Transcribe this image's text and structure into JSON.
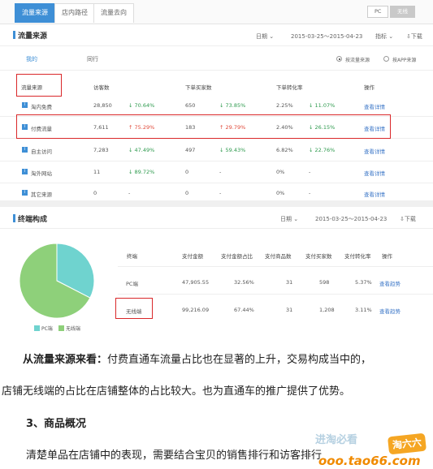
{
  "tabs": [
    "流量来源",
    "店内路径",
    "流量去向"
  ],
  "device_toggle": [
    "PC",
    "无线"
  ],
  "traffic": {
    "title": "流量来源",
    "date_label": "日期",
    "date_range": "2015-03-25～2015-04-23",
    "metric_label": "指标",
    "download": "下载",
    "subtabs": [
      "我的",
      "同行"
    ],
    "radio": [
      "按流量来源",
      "按APP来源"
    ],
    "headers": [
      "流量来源",
      "访客数",
      "下单买家数",
      "下单转化率",
      "操作"
    ],
    "rows": [
      {
        "name": "淘内免费",
        "visitors": "28,850",
        "v_delta": "70.64%",
        "v_dir": "down",
        "buyers": "650",
        "b_delta": "73.85%",
        "b_dir": "down",
        "rate": "2.25%",
        "r_delta": "11.07%",
        "r_dir": "down",
        "action": "查看详情"
      },
      {
        "name": "付费流量",
        "visitors": "7,611",
        "v_delta": "75.29%",
        "v_dir": "up",
        "buyers": "183",
        "b_delta": "29.79%",
        "b_dir": "up",
        "rate": "2.40%",
        "r_delta": "26.15%",
        "r_dir": "down",
        "action": "查看详情"
      },
      {
        "name": "自主访问",
        "visitors": "7,283",
        "v_delta": "47.49%",
        "v_dir": "down",
        "buyers": "497",
        "b_delta": "59.43%",
        "b_dir": "down",
        "rate": "6.82%",
        "r_delta": "22.76%",
        "r_dir": "down",
        "action": "查看详情"
      },
      {
        "name": "淘外网站",
        "visitors": "11",
        "v_delta": "89.72%",
        "v_dir": "down",
        "buyers": "0",
        "b_delta": "-",
        "b_dir": "",
        "rate": "0%",
        "r_delta": "-",
        "r_dir": "",
        "action": "查看详情"
      },
      {
        "name": "其它来源",
        "visitors": "0",
        "v_delta": "-",
        "v_dir": "",
        "buyers": "0",
        "b_delta": "-",
        "b_dir": "",
        "rate": "0%",
        "r_delta": "-",
        "r_dir": "",
        "action": "查看详情"
      }
    ]
  },
  "terminal": {
    "title": "终端构成",
    "date_label": "日期",
    "date_range": "2015-03-25～2015-04-23",
    "download": "下载",
    "legend": [
      "PC端",
      "无线端"
    ],
    "colors": {
      "pc": "#6fd3cf",
      "mobile": "#8ed07a"
    },
    "pie_fractions": [
      0.3256,
      0.6744
    ],
    "headers": [
      "终端",
      "支付金额",
      "支付金额占比",
      "支付商品数",
      "支付买家数",
      "支付转化率",
      "操作"
    ],
    "rows": [
      {
        "name": "PC端",
        "amount": "47,905.55",
        "share": "32.56%",
        "items": "31",
        "buyers": "598",
        "rate": "5.37%",
        "action": "查看趋势"
      },
      {
        "name": "无线端",
        "amount": "99,216.09",
        "share": "67.44%",
        "items": "31",
        "buyers": "1,208",
        "rate": "3.11%",
        "action": "查看趋势"
      }
    ]
  },
  "article": {
    "p1_bold": "从流量来源来看：",
    "p1_rest": "付费直通车流量占比也在显著的上升，交易构成当中的，",
    "p2": "店铺无线端的占比在店铺整体的占比较大。也为直通车的推广提供了优势。",
    "heading": "3、商品概况",
    "p3": "清楚单品在店铺中的表现，需要结合宝贝的销售排行和访客排行"
  },
  "watermark": {
    "site": "ooo.tao66.com",
    "brand": "淘六六",
    "slogan": "进淘必看"
  }
}
